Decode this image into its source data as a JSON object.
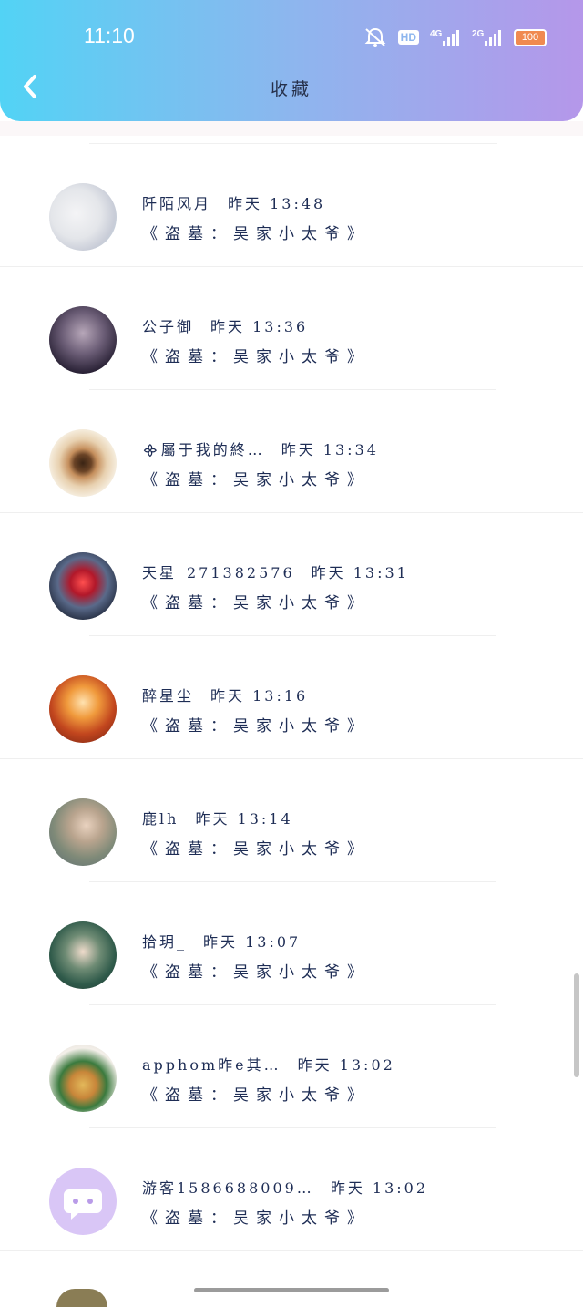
{
  "status_bar": {
    "time": "11:10",
    "battery": "100",
    "network1": "4G",
    "network2": "2G",
    "hd": "HD"
  },
  "header": {
    "title": "收藏"
  },
  "items": [
    {
      "name": "阡陌风月",
      "time": "昨天 13:48",
      "desc": "《盗墓：吴家小太爷》",
      "avatar_bg": "radial-gradient(circle at 40% 45%, #f4f4f6 0%, #e4e6ea 45%, #c9cdd8 70%, #b7d3df 100%)"
    },
    {
      "name": "公子御",
      "time": "昨天 13:36",
      "desc": "《盗墓：吴家小太爷》",
      "avatar_bg": "radial-gradient(circle at 50% 40%, #b7a7b9 0%, #6b5d76 40%, #2a2236 75%, #17121c 100%)"
    },
    {
      "name": "᯽屬于我的終…",
      "time": "昨天 13:34",
      "desc": "《盗墓：吴家小太爷》",
      "avatar_bg": "radial-gradient(circle at 50% 50%, #3a2414 0%, #6a4326 18%, #c58f5d 30%, #e8d1b0 50%, #f5ecdc 70%, #6b6e5a 100%)"
    },
    {
      "name": "天星_271382576",
      "time": "昨天 13:31",
      "desc": "《盗墓：吴家小太爷》",
      "avatar_bg": "radial-gradient(circle at 50% 45%, #ff4f4f 0%, #b2182a 25%, #5a6a8a 50%, #20283a 80%, #0f1320 100%)"
    },
    {
      "name": "醉星尘",
      "time": "昨天 13:16",
      "desc": "《盗墓：吴家小太爷》",
      "avatar_bg": "radial-gradient(circle at 50% 40%, #ffe2b0 0%, #f09a3c 30%, #c2461e 60%, #6e1f12 100%)"
    },
    {
      "name": "鹿lh",
      "time": "昨天 13:14",
      "desc": "《盗墓：吴家小太爷》",
      "avatar_bg": "radial-gradient(circle at 55% 40%, #e9d2bf 0%, #b9a48e 30%, #7f8a78 60%, #5a6b73 100%)"
    },
    {
      "name": "拾玥_",
      "time": "昨天 13:07",
      "desc": "《盗墓：吴家小太爷》",
      "avatar_bg": "radial-gradient(circle at 50% 45%, #f0dccc 0%, #6e8b74 35%, #2f5a4a 65%, #1f3530 100%)"
    },
    {
      "name": "apphom昨e其…",
      "time": "昨天 13:02",
      "desc": "《盗墓：吴家小太爷》",
      "avatar_bg": "radial-gradient(circle at 50% 60%, #e3b85a 0%, #c8863a 25%, #3a7a3e 45%, #f3efe9 70%, #dcd6cf 100%)"
    },
    {
      "name": "游客1586688009…",
      "time": "昨天 13:02",
      "desc": "《盗墓：吴家小太爷》",
      "avatar_bg": "#d9c6f6"
    }
  ]
}
